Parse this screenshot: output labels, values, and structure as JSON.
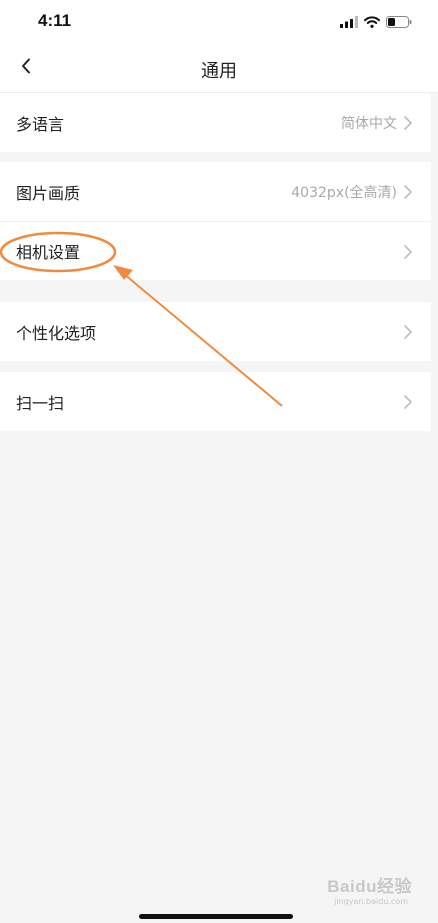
{
  "status_bar": {
    "time": "4:11"
  },
  "nav": {
    "title": "通用",
    "back_icon": "chevron-left-icon"
  },
  "sections": [
    {
      "rows": [
        {
          "label": "多语言",
          "value": "简体中文"
        }
      ]
    },
    {
      "rows": [
        {
          "label": "图片画质",
          "value": "4032px(全高清)"
        },
        {
          "label": "相机设置",
          "value": ""
        }
      ]
    },
    {
      "rows": [
        {
          "label": "个性化选项",
          "value": ""
        }
      ]
    },
    {
      "rows": [
        {
          "label": "扫一扫",
          "value": ""
        }
      ]
    }
  ],
  "annotation": {
    "color": "#f08a3c",
    "target": "相机设置"
  },
  "watermark": {
    "text": "Baidu经验",
    "sub": "jingyan.baidu.com"
  }
}
